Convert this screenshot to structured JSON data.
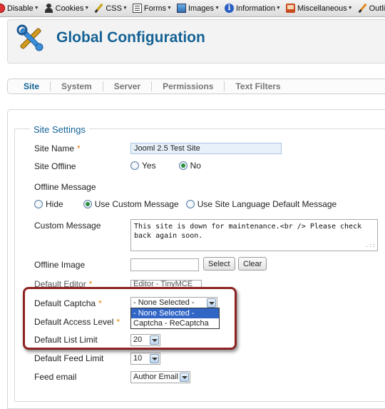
{
  "toolbar": {
    "items": [
      {
        "label": "Disable",
        "icon": "disable-icon"
      },
      {
        "label": "Cookies",
        "icon": "cookies-icon"
      },
      {
        "label": "CSS",
        "icon": "css-icon"
      },
      {
        "label": "Forms",
        "icon": "forms-icon"
      },
      {
        "label": "Images",
        "icon": "images-icon"
      },
      {
        "label": "Information",
        "icon": "information-icon"
      },
      {
        "label": "Miscellaneous",
        "icon": "miscellaneous-icon"
      },
      {
        "label": "Outline",
        "icon": "outline-icon"
      }
    ]
  },
  "header": {
    "title": "Global Configuration",
    "icon": "tools-icon"
  },
  "tabs": [
    {
      "label": "Site",
      "active": true
    },
    {
      "label": "System",
      "active": false
    },
    {
      "label": "Server",
      "active": false
    },
    {
      "label": "Permissions",
      "active": false
    },
    {
      "label": "Text Filters",
      "active": false
    }
  ],
  "site_settings": {
    "legend": "Site Settings",
    "site_name": {
      "label": "Site Name",
      "required": "*",
      "value": "Jooml 2.5 Test Site"
    },
    "site_offline": {
      "label": "Site Offline",
      "options": [
        "Yes",
        "No"
      ],
      "selected": "No"
    },
    "offline_message": {
      "label": "Offline Message",
      "options": [
        "Hide",
        "Use Custom Message",
        "Use Site Language Default Message"
      ],
      "selected": "Use Custom Message"
    },
    "custom_message": {
      "label": "Custom Message",
      "value": "This site is down for maintenance.<br /> Please check back again soon."
    },
    "offline_image": {
      "label": "Offline Image",
      "value": "",
      "select_label": "Select",
      "clear_label": "Clear"
    },
    "default_editor": {
      "label": "Default Editor",
      "required": "*",
      "value": "Editor - TinyMCE"
    },
    "default_captcha": {
      "label": "Default Captcha",
      "required": "*",
      "value": "- None Selected -",
      "options": [
        "- None Selected -",
        "Captcha - ReCaptcha"
      ],
      "highlighted": "- None Selected -"
    },
    "default_access_level": {
      "label": "Default Access Level",
      "required": "*"
    },
    "default_list_limit": {
      "label": "Default List Limit",
      "value": "20"
    },
    "default_feed_limit": {
      "label": "Default Feed Limit",
      "value": "10"
    },
    "feed_email": {
      "label": "Feed email",
      "value": "Author Email"
    }
  },
  "colors": {
    "accent": "#146295",
    "required": "#eb8207",
    "highlight_frame": "#8d2222",
    "selected_option": "#3166c7"
  }
}
